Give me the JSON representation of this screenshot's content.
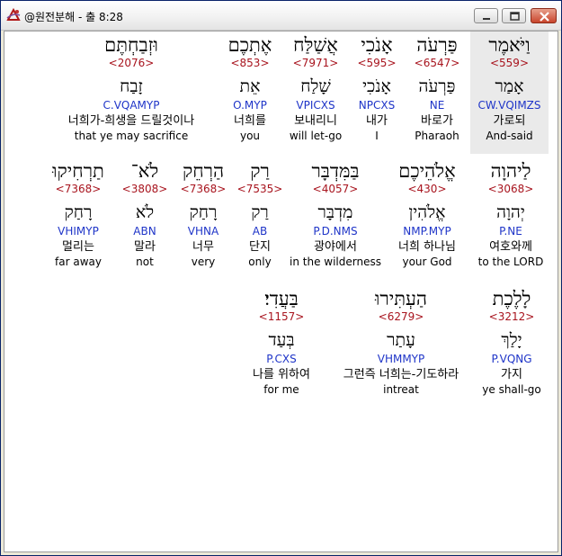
{
  "window": {
    "title": "@원전분해 - 출 8:28"
  },
  "rows": [
    [
      {
        "hebrew": "וַיֹּאמֶר",
        "strong": "<559>",
        "lemma": "אָמַר",
        "parse": "CW.VQIMZS",
        "korean": "가로되",
        "english": "And-said",
        "selected": true
      },
      {
        "hebrew": "פַּרְעֹה",
        "strong": "<6547>",
        "lemma": "פַּרְעֹה",
        "parse": "NE",
        "korean": "바로가",
        "english": "Pharaoh"
      },
      {
        "hebrew": "אָנֹכִי",
        "strong": "<595>",
        "lemma": "אָנֹכִי",
        "parse": "NPCXS",
        "korean": "내가",
        "english": "I"
      },
      {
        "hebrew": "אֲשַׁלַּח",
        "strong": "<7971>",
        "lemma": "שָׁלַח",
        "parse": "VPICXS",
        "korean": "보내리니",
        "english": "will let-go"
      },
      {
        "hebrew": "אֶתְכֶם",
        "strong": "<853>",
        "lemma": "אֵת",
        "parse": "O.MYP",
        "korean": "너희를",
        "english": "you"
      },
      {
        "hebrew": "וּזְבַחְתֶּם",
        "strong": "<2076>",
        "lemma": "זָבַח",
        "parse": "C.VQAMYP",
        "korean": "너희가-희생을 드릴것이나",
        "english": "that ye may sacrifice"
      }
    ],
    [
      {
        "hebrew": "לַיהוָה",
        "strong": "<3068>",
        "lemma": "יְהוָה",
        "parse": "P.NE",
        "korean": "여호와께",
        "english": "to the LORD"
      },
      {
        "hebrew": "אֱלֹהֵיכֶם",
        "strong": "<430>",
        "lemma": "אֱלֹהִין",
        "parse": "NMP.MYP",
        "korean": "너희 하나님",
        "english": "your God"
      },
      {
        "hebrew": "בַּמִּדְבָּר",
        "strong": "<4057>",
        "lemma": "מִדְבָּר",
        "parse": "P.D.NMS",
        "korean": "광야에서",
        "english": "in the wilderness"
      },
      {
        "hebrew": "רַק",
        "strong": "<7535>",
        "lemma": "רַק",
        "parse": "AB",
        "korean": "단지",
        "english": "only"
      },
      {
        "hebrew": "הַרְחֵק",
        "strong": "<7368>",
        "lemma": "רָחַק",
        "parse": "VHNA",
        "korean": "너무",
        "english": "very"
      },
      {
        "hebrew": "לֹא־",
        "strong": "<3808>",
        "lemma": "לֹא",
        "parse": "ABN",
        "korean": "말라",
        "english": "not"
      },
      {
        "hebrew": "תַרְחִיקוּ",
        "strong": "<7368>",
        "lemma": "רָחַק",
        "parse": "VHIMYP",
        "korean": "멀리는",
        "english": "far away"
      }
    ],
    [
      {
        "hebrew": "לָלֶכֶת",
        "strong": "<3212>",
        "lemma": "יָלַךְ",
        "parse": "P.VQNG",
        "korean": "가지",
        "english": "ye shall-go"
      },
      {
        "hebrew": "הַעְתִּירוּ",
        "strong": "<6279>",
        "lemma": "עָתַר",
        "parse": "VHMMYP",
        "korean": "그런즉 너희는-기도하라",
        "english": "intreat"
      },
      {
        "hebrew": "בַּעֲדִי׃",
        "strong": "<1157>",
        "lemma": "בְּעַד",
        "parse": "P.CXS",
        "korean": "나를 위하여",
        "english": "for me"
      }
    ]
  ]
}
